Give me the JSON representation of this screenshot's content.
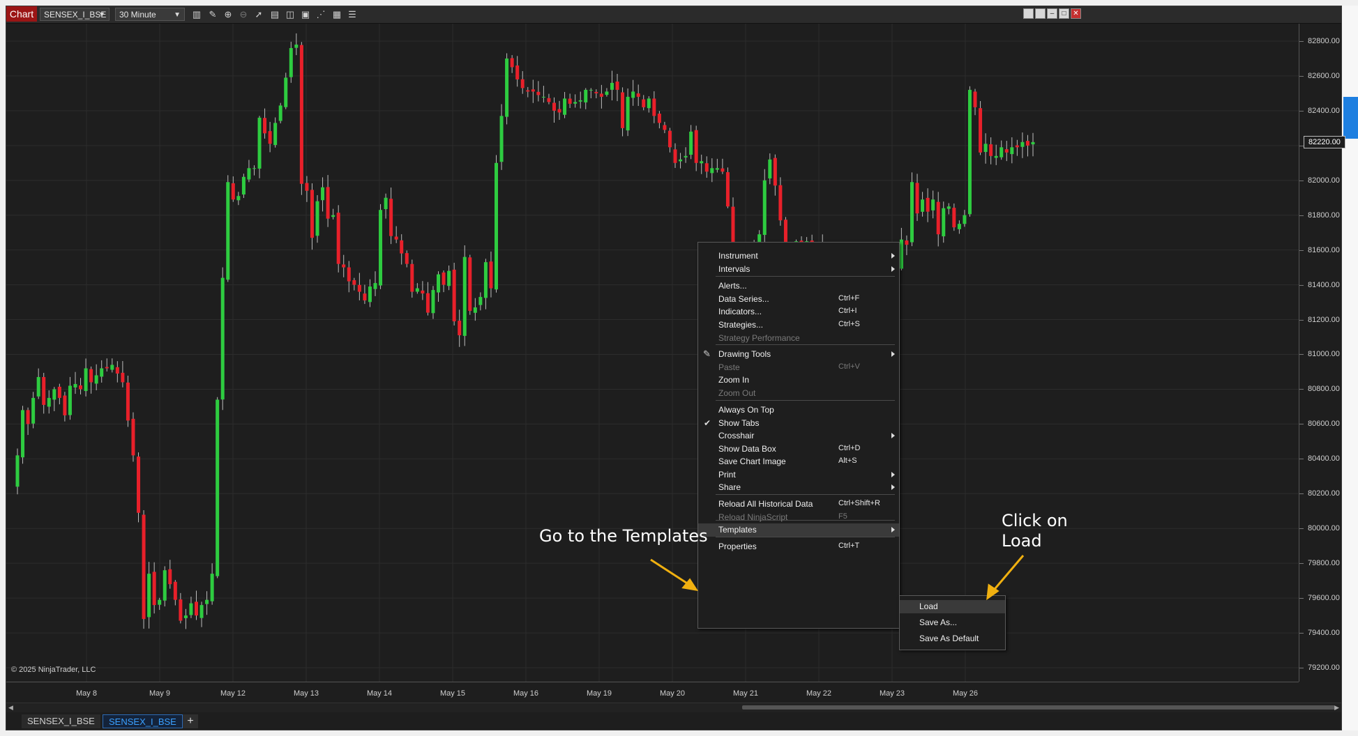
{
  "toolbar": {
    "chart_label": "Chart",
    "instrument": "SENSEX_I_BSE",
    "interval": "30 Minute",
    "icons": [
      "bar-type-icon",
      "draw-icon",
      "zoom-in-icon",
      "zoom-out-icon",
      "pointer-icon",
      "data-series-icon",
      "indicators-icon",
      "strategies-icon",
      "plot-icon",
      "snapshot-icon",
      "properties-icon"
    ]
  },
  "chart_data": {
    "type": "candlestick",
    "instrument": "SENSEX_I_BSE",
    "interval": "30 Minute",
    "y_ticks": [
      "82800.00",
      "82600.00",
      "82400.00",
      "82200.00",
      "82000.00",
      "81800.00",
      "81600.00",
      "81400.00",
      "81200.00",
      "81000.00",
      "80800.00",
      "80600.00",
      "80400.00",
      "80200.00",
      "80000.00",
      "79800.00",
      "79600.00",
      "79400.00",
      "79200.00"
    ],
    "ylim": [
      79120,
      82900
    ],
    "x_ticks": [
      "May 8",
      "May 9",
      "May 12",
      "May 13",
      "May 14",
      "May 15",
      "May 16",
      "May 19",
      "May 20",
      "May 21",
      "May 22",
      "May 23",
      "May 26"
    ],
    "last_price": "82220.00",
    "up_color": "#2ecc40",
    "down_color": "#e8202a",
    "grid": true,
    "closes": [
      80420,
      80680,
      80600,
      80750,
      80870,
      80710,
      80750,
      80800,
      80750,
      80650,
      80820,
      80830,
      80800,
      80920,
      80840,
      80880,
      80920,
      80920,
      80940,
      80890,
      80840,
      80620,
      80420,
      80090,
      79480,
      79740,
      79560,
      79590,
      79760,
      79680,
      79590,
      79470,
      79500,
      79570,
      79500,
      79560,
      79590,
      79740,
      80740,
      81440,
      81990,
      81890,
      81910,
      82020,
      82070,
      82070,
      82360,
      82270,
      82210,
      82330,
      82430,
      82590,
      82760,
      82780,
      81980,
      81940,
      81670,
      81880,
      81960,
      81780,
      81800,
      81520,
      81500,
      81420,
      81400,
      81360,
      81310,
      81390,
      81410,
      81830,
      81900,
      81680,
      81660,
      81580,
      81520,
      81360,
      81380,
      81350,
      81240,
      81370,
      81460,
      81400,
      81480,
      81190,
      81110,
      81560,
      81250,
      81270,
      81330,
      81530,
      81380,
      82100,
      82370,
      82700,
      82650,
      82580,
      82530,
      82510,
      82510,
      82490,
      82480,
      82450,
      82400,
      82390,
      82470,
      82440,
      82450,
      82460,
      82520,
      82520,
      82500,
      82480,
      82510,
      82560,
      82520,
      82300,
      82480,
      82510,
      82480,
      82420,
      82470,
      82370,
      82330,
      82290,
      82190,
      82100,
      82120,
      82140,
      82280,
      82100,
      82110,
      82050,
      82070,
      82070,
      82050,
      81850,
      81560,
      81470,
      81570,
      81550,
      81590,
      81690,
      82000,
      82120,
      81970,
      81770,
      81510,
      81610,
      81650,
      81550,
      81650,
      81630,
      81620,
      81620,
      80890,
      80960,
      81000,
      80900,
      80840,
      80800,
      80810,
      80780,
      80710,
      80740,
      80730,
      80910,
      81080,
      81480,
      81660,
      81630,
      81990,
      81810,
      81890,
      81820,
      81890,
      81690,
      81840,
      81850,
      81730,
      81750,
      81800,
      82520,
      82420,
      82160,
      82210,
      82140,
      82140,
      82190,
      82160,
      82190,
      82190,
      82220,
      82200,
      82220
    ]
  },
  "copyright": "© 2025 NinjaTrader, LLC",
  "tabs": [
    "SENSEX_I_BSE",
    "SENSEX_I_BSE"
  ],
  "tab_add": "+",
  "context_menu": {
    "items": [
      {
        "label": "Instrument",
        "shortcut": "",
        "submenu": true
      },
      {
        "label": "Intervals",
        "shortcut": "",
        "submenu": true
      },
      {
        "label": "Alerts...",
        "shortcut": ""
      },
      {
        "label": "Data Series...",
        "shortcut": "Ctrl+F"
      },
      {
        "label": "Indicators...",
        "shortcut": "Ctrl+I"
      },
      {
        "label": "Strategies...",
        "shortcut": "Ctrl+S"
      },
      {
        "label": "Strategy Performance",
        "shortcut": "",
        "disabled": true
      },
      {
        "label": "Drawing Tools",
        "shortcut": "",
        "submenu": true
      },
      {
        "label": "Paste",
        "shortcut": "Ctrl+V",
        "disabled": true
      },
      {
        "label": "Zoom In",
        "shortcut": ""
      },
      {
        "label": "Zoom Out",
        "shortcut": "",
        "disabled": true
      },
      {
        "label": "Always On Top",
        "shortcut": ""
      },
      {
        "label": "Show Tabs",
        "shortcut": "",
        "checked": true
      },
      {
        "label": "Crosshair",
        "shortcut": "",
        "submenu": true
      },
      {
        "label": "Show Data Box",
        "shortcut": "Ctrl+D"
      },
      {
        "label": "Save Chart Image",
        "shortcut": "Alt+S"
      },
      {
        "label": "Print",
        "shortcut": "",
        "submenu": true
      },
      {
        "label": "Share",
        "shortcut": "",
        "submenu": true
      },
      {
        "label": "Reload All Historical Data",
        "shortcut": "Ctrl+Shift+R"
      },
      {
        "label": "Reload NinjaScript",
        "shortcut": "F5",
        "disabled": true
      },
      {
        "label": "Templates",
        "shortcut": "",
        "submenu": true
      },
      {
        "label": "Properties",
        "shortcut": "Ctrl+T"
      }
    ]
  },
  "templates_submenu": [
    "Load",
    "Save As...",
    "Save As Default"
  ],
  "annotations": {
    "templates_note": "Go to the Templates",
    "load_note_line1": "Click on",
    "load_note_line2": "Load"
  }
}
